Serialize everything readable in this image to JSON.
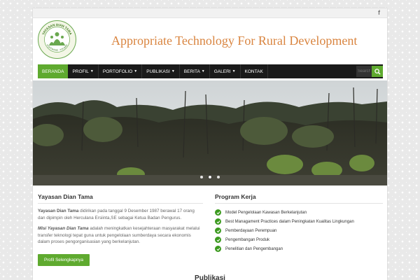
{
  "topbar": {
    "social_icon": "facebook-icon",
    "social_glyph": "f"
  },
  "header": {
    "logo_text_top": "YAYASAN DIAN TAMA",
    "logo_text_bottom": "PONTIANAK - KALBAR",
    "site_title": "Appropriate Technology For Rural Development"
  },
  "nav": {
    "items": [
      {
        "label": "Beranda",
        "active": true,
        "has_dropdown": false
      },
      {
        "label": "Profil",
        "has_dropdown": true
      },
      {
        "label": "Portofolio",
        "has_dropdown": true
      },
      {
        "label": "Publikasi",
        "has_dropdown": true
      },
      {
        "label": "Berita",
        "has_dropdown": true
      },
      {
        "label": "Galeri",
        "has_dropdown": true
      },
      {
        "label": "Kontak",
        "has_dropdown": false
      }
    ],
    "search_placeholder": "Search",
    "caret": "▼"
  },
  "slider": {
    "dots": 3,
    "active_dot": 1
  },
  "about": {
    "title": "Yayasan Dian Tama",
    "p1_strong": "Yayasan Dian Tama",
    "p1_rest": " didirikan pada tanggal 9 Desember 1987 berawal 17 orang dan dipimpin oleh Herculana Ersiinta,SE sebagai Ketua Badan Pengurus.",
    "p2_strong": "Misi Yayasan Dian Tama",
    "p2_rest": " adalah meningkatkan kesejahteraan masyarakat melalui transfer teknologi tepat guna untuk pengelolaan sumberdaya secara ekonomis dalam proses pengorganisasian yang berkelanjutan.",
    "button_label": "Profil Selengkapnya"
  },
  "program": {
    "title": "Program Kerja",
    "items": [
      "Model Pengelolaan Kawasan Berkelanjutan",
      "Best Managament Practices dalam Peningkatan Kualitas Lingkungan",
      "Pemberdayaan Perempuan",
      "Pengembangan Produk",
      "Penelitian dan Pengembangan"
    ]
  },
  "publikasi_title": "Publikasi",
  "colors": {
    "accent": "#5faa2f",
    "title": "#d9843f",
    "nav_bg": "#1a1a1a"
  }
}
